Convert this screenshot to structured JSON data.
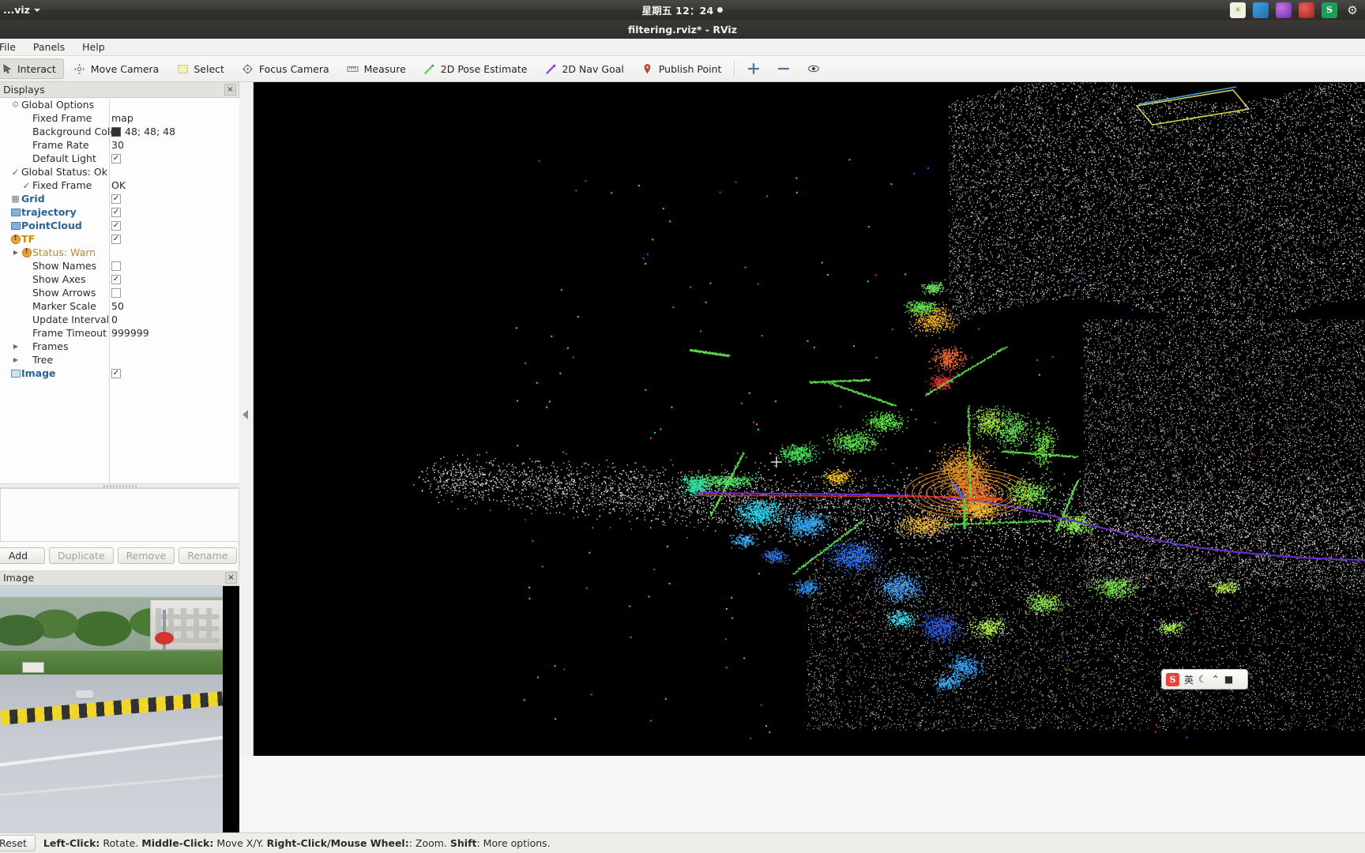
{
  "unity_bar": {
    "app_name": "...viz",
    "clock": "星期五 12：24",
    "tray_icons": [
      "brightness-icon",
      "files-icon",
      "updates-icon",
      "shutdown-icon",
      "sogou-icon",
      "gear-icon"
    ]
  },
  "window": {
    "title": "filtering.rviz* - RViz"
  },
  "menubar": {
    "items": [
      {
        "label": "File"
      },
      {
        "label": "Panels"
      },
      {
        "label": "Help"
      }
    ]
  },
  "toolbar": {
    "tools": [
      {
        "label": "Interact",
        "icon": "interact-icon",
        "active": true
      },
      {
        "label": "Move Camera",
        "icon": "move-camera-icon",
        "active": false
      },
      {
        "label": "Select",
        "icon": "select-icon",
        "active": false
      },
      {
        "label": "Focus Camera",
        "icon": "focus-camera-icon",
        "active": false
      },
      {
        "label": "Measure",
        "icon": "measure-icon",
        "active": false
      },
      {
        "label": "2D Pose Estimate",
        "icon": "pose-estimate-icon",
        "active": false
      },
      {
        "label": "2D Nav Goal",
        "icon": "nav-goal-icon",
        "active": false
      },
      {
        "label": "Publish Point",
        "icon": "publish-point-icon",
        "active": false
      }
    ],
    "extra_icons": [
      "add-tool-icon",
      "remove-tool-icon",
      "hide-tool-icon"
    ]
  },
  "displays_panel": {
    "title": "Displays",
    "close_label": "×",
    "rows": [
      {
        "indent": 1,
        "arrow": "",
        "icon": "gear-icon",
        "label": "Global Options",
        "style": "plain",
        "value_type": "none",
        "value": ""
      },
      {
        "indent": 2,
        "arrow": "",
        "icon": "",
        "label": "Fixed Frame",
        "style": "plain",
        "value_type": "text",
        "value": "map"
      },
      {
        "indent": 2,
        "arrow": "",
        "icon": "",
        "label": "Background Color",
        "style": "plain",
        "value_type": "color",
        "value": "48; 48; 48",
        "color": "#303030"
      },
      {
        "indent": 2,
        "arrow": "",
        "icon": "",
        "label": "Frame Rate",
        "style": "plain",
        "value_type": "text",
        "value": "30"
      },
      {
        "indent": 2,
        "arrow": "",
        "icon": "",
        "label": "Default Light",
        "style": "plain",
        "value_type": "checkbox",
        "value": "checked"
      },
      {
        "indent": 1,
        "arrow": "",
        "icon": "check-icon",
        "label": "Global Status: Ok",
        "style": "plain",
        "value_type": "none",
        "value": ""
      },
      {
        "indent": 2,
        "arrow": "",
        "icon": "check-icon",
        "label": "Fixed Frame",
        "style": "plain",
        "value_type": "text",
        "value": "OK"
      },
      {
        "indent": 1,
        "arrow": "",
        "icon": "grid-icon",
        "label": "Grid",
        "style": "link",
        "value_type": "checkbox",
        "value": "checked"
      },
      {
        "indent": 1,
        "arrow": "",
        "icon": "folder-icon",
        "label": "trajectory",
        "style": "link",
        "value_type": "checkbox",
        "value": "checked"
      },
      {
        "indent": 1,
        "arrow": "",
        "icon": "folder-icon",
        "label": "PointCloud",
        "style": "link",
        "value_type": "checkbox",
        "value": "checked"
      },
      {
        "indent": 1,
        "arrow": "",
        "icon": "warn-icon",
        "label": "TF",
        "style": "orange",
        "value_type": "checkbox",
        "value": "checked"
      },
      {
        "indent": 2,
        "arrow": "▶",
        "icon": "warn-icon",
        "label": "Status: Warn",
        "style": "warn",
        "value_type": "none",
        "value": ""
      },
      {
        "indent": 2,
        "arrow": "",
        "icon": "",
        "label": "Show Names",
        "style": "plain",
        "value_type": "checkbox",
        "value": "unchecked"
      },
      {
        "indent": 2,
        "arrow": "",
        "icon": "",
        "label": "Show Axes",
        "style": "plain",
        "value_type": "checkbox",
        "value": "checked"
      },
      {
        "indent": 2,
        "arrow": "",
        "icon": "",
        "label": "Show Arrows",
        "style": "plain",
        "value_type": "checkbox",
        "value": "unchecked"
      },
      {
        "indent": 2,
        "arrow": "",
        "icon": "",
        "label": "Marker Scale",
        "style": "plain",
        "value_type": "text",
        "value": "50"
      },
      {
        "indent": 2,
        "arrow": "",
        "icon": "",
        "label": "Update Interval",
        "style": "plain",
        "value_type": "text",
        "value": "0"
      },
      {
        "indent": 2,
        "arrow": "",
        "icon": "",
        "label": "Frame Timeout",
        "style": "plain",
        "value_type": "text",
        "value": "999999"
      },
      {
        "indent": 2,
        "arrow": "▶",
        "icon": "",
        "label": "Frames",
        "style": "plain",
        "value_type": "none",
        "value": ""
      },
      {
        "indent": 2,
        "arrow": "▶",
        "icon": "",
        "label": "Tree",
        "style": "plain",
        "value_type": "none",
        "value": ""
      },
      {
        "indent": 1,
        "arrow": "",
        "icon": "image-icon",
        "label": "Image",
        "style": "link",
        "value_type": "checkbox",
        "value": "checked"
      }
    ],
    "buttons": [
      {
        "label": "Add",
        "enabled": true
      },
      {
        "label": "Duplicate",
        "enabled": false
      },
      {
        "label": "Remove",
        "enabled": false
      },
      {
        "label": "Rename",
        "enabled": false
      }
    ]
  },
  "image_panel": {
    "title": "Image",
    "close_label": "×"
  },
  "statusbar": {
    "reset_label": "Reset",
    "hint_parts": [
      {
        "text": "Left-Click:",
        "bold": true
      },
      {
        "text": " Rotate. ",
        "bold": false
      },
      {
        "text": "Middle-Click:",
        "bold": true
      },
      {
        "text": " Move X/Y. ",
        "bold": false
      },
      {
        "text": "Right-Click/Mouse Wheel:",
        "bold": true
      },
      {
        "text": ": Zoom. ",
        "bold": false
      },
      {
        "text": "Shift",
        "bold": true
      },
      {
        "text": ": More options.",
        "bold": false
      }
    ]
  },
  "ime": {
    "logo": "S",
    "mode_label": "英",
    "icons": [
      "moon-icon",
      "keyboard-icon",
      "toolbox-icon"
    ]
  },
  "colors": {
    "view_background": "#000000",
    "panel_background": "#fbfbfa",
    "link_text": "#2a6496",
    "warn_text": "#b08a34",
    "accent_orange": "#c98900"
  }
}
